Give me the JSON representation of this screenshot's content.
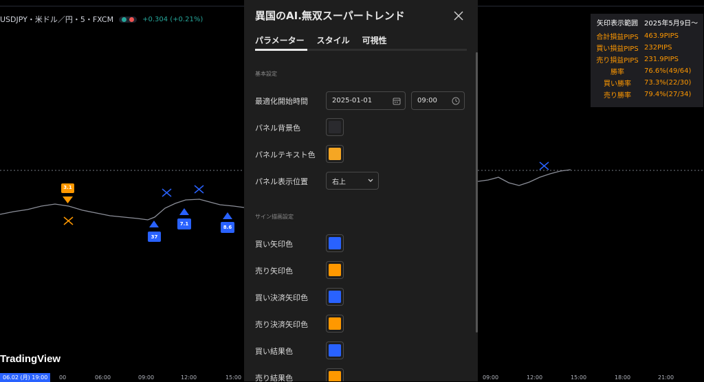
{
  "chart": {
    "symbol": "USDJPY・米ドル／円・5・FXCM",
    "change": "+0.304 (+0.21%)",
    "logo": "TradingView",
    "date_badge": "06.02 (月)  19:00",
    "ticks_left": [
      "00",
      "06:00",
      "09:00",
      "12:00",
      "15:00"
    ],
    "ticks_right": [
      "09:00",
      "12:00",
      "15:00",
      "18:00",
      "21:00"
    ],
    "markers": {
      "m1": "3.1",
      "m2": "37",
      "m3": "7.1",
      "m4": "8.6"
    },
    "colors": {
      "buy": "#2962ff",
      "sell": "#ff9800",
      "up": "#26a69a",
      "down": "#ef5350"
    }
  },
  "stats_panel": {
    "header": {
      "label": "矢印表示範囲",
      "value": "2025年5月9日〜"
    },
    "rows": [
      {
        "label": "合計損益PIPS",
        "value": "463.9PIPS"
      },
      {
        "label": "買い損益PIPS",
        "value": "232PIPS"
      },
      {
        "label": "売り損益PIPS",
        "value": "231.9PIPS"
      },
      {
        "label": "勝率",
        "value": "76.6%(49/64)"
      },
      {
        "label": "買い勝率",
        "value": "73.3%(22/30)"
      },
      {
        "label": "売り勝率",
        "value": "79.4%(27/34)"
      }
    ]
  },
  "dialog": {
    "title": "異国のAI.無双スーパートレンド",
    "tabs": [
      "パラメーター",
      "スタイル",
      "可視性"
    ],
    "section_basic": "基本設定",
    "section_sign": "サイン描画設定",
    "opt_start_label": "最適化開始時間",
    "opt_start_date": "2025-01-01",
    "opt_start_time": "09:00",
    "panel_bg_label": "パネル背景色",
    "panel_bg_color": "#2a2a2e",
    "panel_text_label": "パネルテキスト色",
    "panel_text_color": "#f5a623",
    "panel_pos_label": "パネル表示位置",
    "panel_pos_value": "右上",
    "colors": [
      {
        "label": "買い矢印色",
        "color": "#2962ff"
      },
      {
        "label": "売り矢印色",
        "color": "#ff9800"
      },
      {
        "label": "買い決済矢印色",
        "color": "#2962ff"
      },
      {
        "label": "売り決済矢印色",
        "color": "#ff9800"
      },
      {
        "label": "買い結果色",
        "color": "#2962ff"
      },
      {
        "label": "売り結果色",
        "color": "#ff9800"
      }
    ]
  }
}
